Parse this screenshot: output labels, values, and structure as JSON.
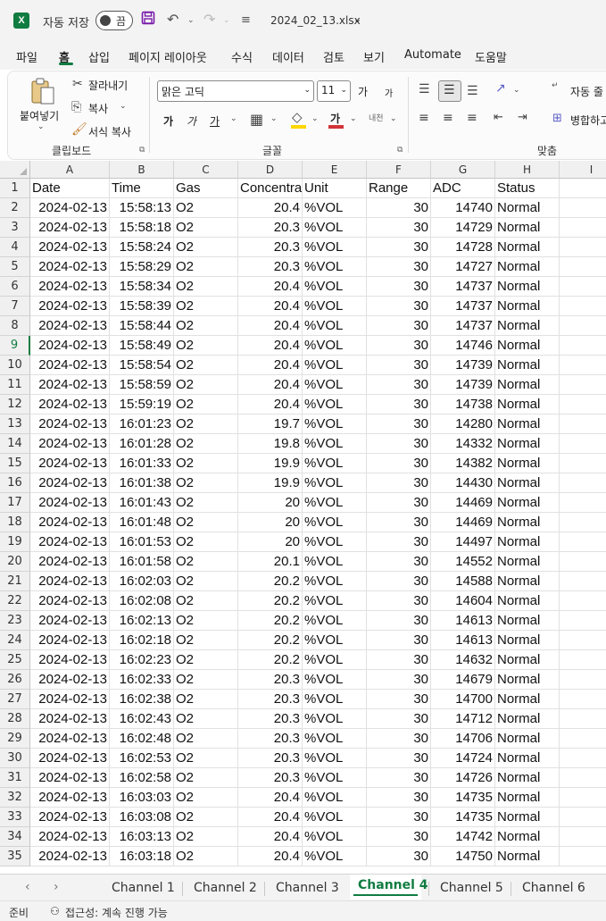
{
  "titlebar": {
    "app_icon": "X",
    "autosave_label": "자동 저장",
    "autosave_state": "끔",
    "filename": "2024_02_13.xlsx",
    "icons": [
      "excel-icon",
      "save-icon",
      "undo-icon",
      "redo-icon",
      "customize-qat-icon",
      "chevron-down-icon"
    ]
  },
  "menu": [
    "파일",
    "홈",
    "삽입",
    "페이지 레이아웃",
    "수식",
    "데이터",
    "검토",
    "보기",
    "Automate",
    "도움말"
  ],
  "active_menu": "홈",
  "ribbon": {
    "clipboard": {
      "paste": "붙여넣기",
      "cut": "잘라내기",
      "copy": "복사",
      "format_painter": "서식 복사",
      "label": "클립보드"
    },
    "font": {
      "name": "맑은 고딕",
      "size": "11",
      "grow": "가",
      "shrink": "가",
      "bold": "가",
      "italic": "가",
      "underline": "가",
      "font_color": "가",
      "phonetic": "내천",
      "label": "글꼴"
    },
    "alignment": {
      "wrap_label": "자동 줄",
      "merge_label": "병합하고",
      "label": "맞춤"
    }
  },
  "columns": [
    "A",
    "B",
    "C",
    "D",
    "E",
    "F",
    "G",
    "H",
    "I"
  ],
  "headers": [
    "Date",
    "Time",
    "Gas",
    "Concentra",
    "Unit",
    "Range",
    "ADC",
    "Status"
  ],
  "rows": [
    [
      "2024-02-13",
      "15:58:13",
      "O2",
      "20.4",
      "%VOL",
      "30",
      "14740",
      "Normal"
    ],
    [
      "2024-02-13",
      "15:58:18",
      "O2",
      "20.3",
      "%VOL",
      "30",
      "14729",
      "Normal"
    ],
    [
      "2024-02-13",
      "15:58:24",
      "O2",
      "20.3",
      "%VOL",
      "30",
      "14728",
      "Normal"
    ],
    [
      "2024-02-13",
      "15:58:29",
      "O2",
      "20.3",
      "%VOL",
      "30",
      "14727",
      "Normal"
    ],
    [
      "2024-02-13",
      "15:58:34",
      "O2",
      "20.4",
      "%VOL",
      "30",
      "14737",
      "Normal"
    ],
    [
      "2024-02-13",
      "15:58:39",
      "O2",
      "20.4",
      "%VOL",
      "30",
      "14737",
      "Normal"
    ],
    [
      "2024-02-13",
      "15:58:44",
      "O2",
      "20.4",
      "%VOL",
      "30",
      "14737",
      "Normal"
    ],
    [
      "2024-02-13",
      "15:58:49",
      "O2",
      "20.4",
      "%VOL",
      "30",
      "14746",
      "Normal"
    ],
    [
      "2024-02-13",
      "15:58:54",
      "O2",
      "20.4",
      "%VOL",
      "30",
      "14739",
      "Normal"
    ],
    [
      "2024-02-13",
      "15:58:59",
      "O2",
      "20.4",
      "%VOL",
      "30",
      "14739",
      "Normal"
    ],
    [
      "2024-02-13",
      "15:59:19",
      "O2",
      "20.4",
      "%VOL",
      "30",
      "14738",
      "Normal"
    ],
    [
      "2024-02-13",
      "16:01:23",
      "O2",
      "19.7",
      "%VOL",
      "30",
      "14280",
      "Normal"
    ],
    [
      "2024-02-13",
      "16:01:28",
      "O2",
      "19.8",
      "%VOL",
      "30",
      "14332",
      "Normal"
    ],
    [
      "2024-02-13",
      "16:01:33",
      "O2",
      "19.9",
      "%VOL",
      "30",
      "14382",
      "Normal"
    ],
    [
      "2024-02-13",
      "16:01:38",
      "O2",
      "19.9",
      "%VOL",
      "30",
      "14430",
      "Normal"
    ],
    [
      "2024-02-13",
      "16:01:43",
      "O2",
      "20",
      "%VOL",
      "30",
      "14469",
      "Normal"
    ],
    [
      "2024-02-13",
      "16:01:48",
      "O2",
      "20",
      "%VOL",
      "30",
      "14469",
      "Normal"
    ],
    [
      "2024-02-13",
      "16:01:53",
      "O2",
      "20",
      "%VOL",
      "30",
      "14497",
      "Normal"
    ],
    [
      "2024-02-13",
      "16:01:58",
      "O2",
      "20.1",
      "%VOL",
      "30",
      "14552",
      "Normal"
    ],
    [
      "2024-02-13",
      "16:02:03",
      "O2",
      "20.2",
      "%VOL",
      "30",
      "14588",
      "Normal"
    ],
    [
      "2024-02-13",
      "16:02:08",
      "O2",
      "20.2",
      "%VOL",
      "30",
      "14604",
      "Normal"
    ],
    [
      "2024-02-13",
      "16:02:13",
      "O2",
      "20.2",
      "%VOL",
      "30",
      "14613",
      "Normal"
    ],
    [
      "2024-02-13",
      "16:02:18",
      "O2",
      "20.2",
      "%VOL",
      "30",
      "14613",
      "Normal"
    ],
    [
      "2024-02-13",
      "16:02:23",
      "O2",
      "20.2",
      "%VOL",
      "30",
      "14632",
      "Normal"
    ],
    [
      "2024-02-13",
      "16:02:33",
      "O2",
      "20.3",
      "%VOL",
      "30",
      "14679",
      "Normal"
    ],
    [
      "2024-02-13",
      "16:02:38",
      "O2",
      "20.3",
      "%VOL",
      "30",
      "14700",
      "Normal"
    ],
    [
      "2024-02-13",
      "16:02:43",
      "O2",
      "20.3",
      "%VOL",
      "30",
      "14712",
      "Normal"
    ],
    [
      "2024-02-13",
      "16:02:48",
      "O2",
      "20.3",
      "%VOL",
      "30",
      "14706",
      "Normal"
    ],
    [
      "2024-02-13",
      "16:02:53",
      "O2",
      "20.3",
      "%VOL",
      "30",
      "14724",
      "Normal"
    ],
    [
      "2024-02-13",
      "16:02:58",
      "O2",
      "20.3",
      "%VOL",
      "30",
      "14726",
      "Normal"
    ],
    [
      "2024-02-13",
      "16:03:03",
      "O2",
      "20.4",
      "%VOL",
      "30",
      "14735",
      "Normal"
    ],
    [
      "2024-02-13",
      "16:03:08",
      "O2",
      "20.4",
      "%VOL",
      "30",
      "14735",
      "Normal"
    ],
    [
      "2024-02-13",
      "16:03:13",
      "O2",
      "20.4",
      "%VOL",
      "30",
      "14742",
      "Normal"
    ],
    [
      "2024-02-13",
      "16:03:18",
      "O2",
      "20.4",
      "%VOL",
      "30",
      "14750",
      "Normal"
    ]
  ],
  "selected_row": "9",
  "sheets": [
    "Channel 1",
    "Channel 2",
    "Channel 3",
    "Channel 4",
    "Channel 5",
    "Channel 6"
  ],
  "active_sheet": "Channel 4",
  "status": {
    "ready": "준비",
    "accessibility": "접근성: 계속 진행 가능"
  },
  "colors": {
    "excel_green": "#107c41",
    "save_purple": "#7719aa",
    "font_color_red": "#d13438",
    "highlight_yellow": "#ffd700"
  }
}
